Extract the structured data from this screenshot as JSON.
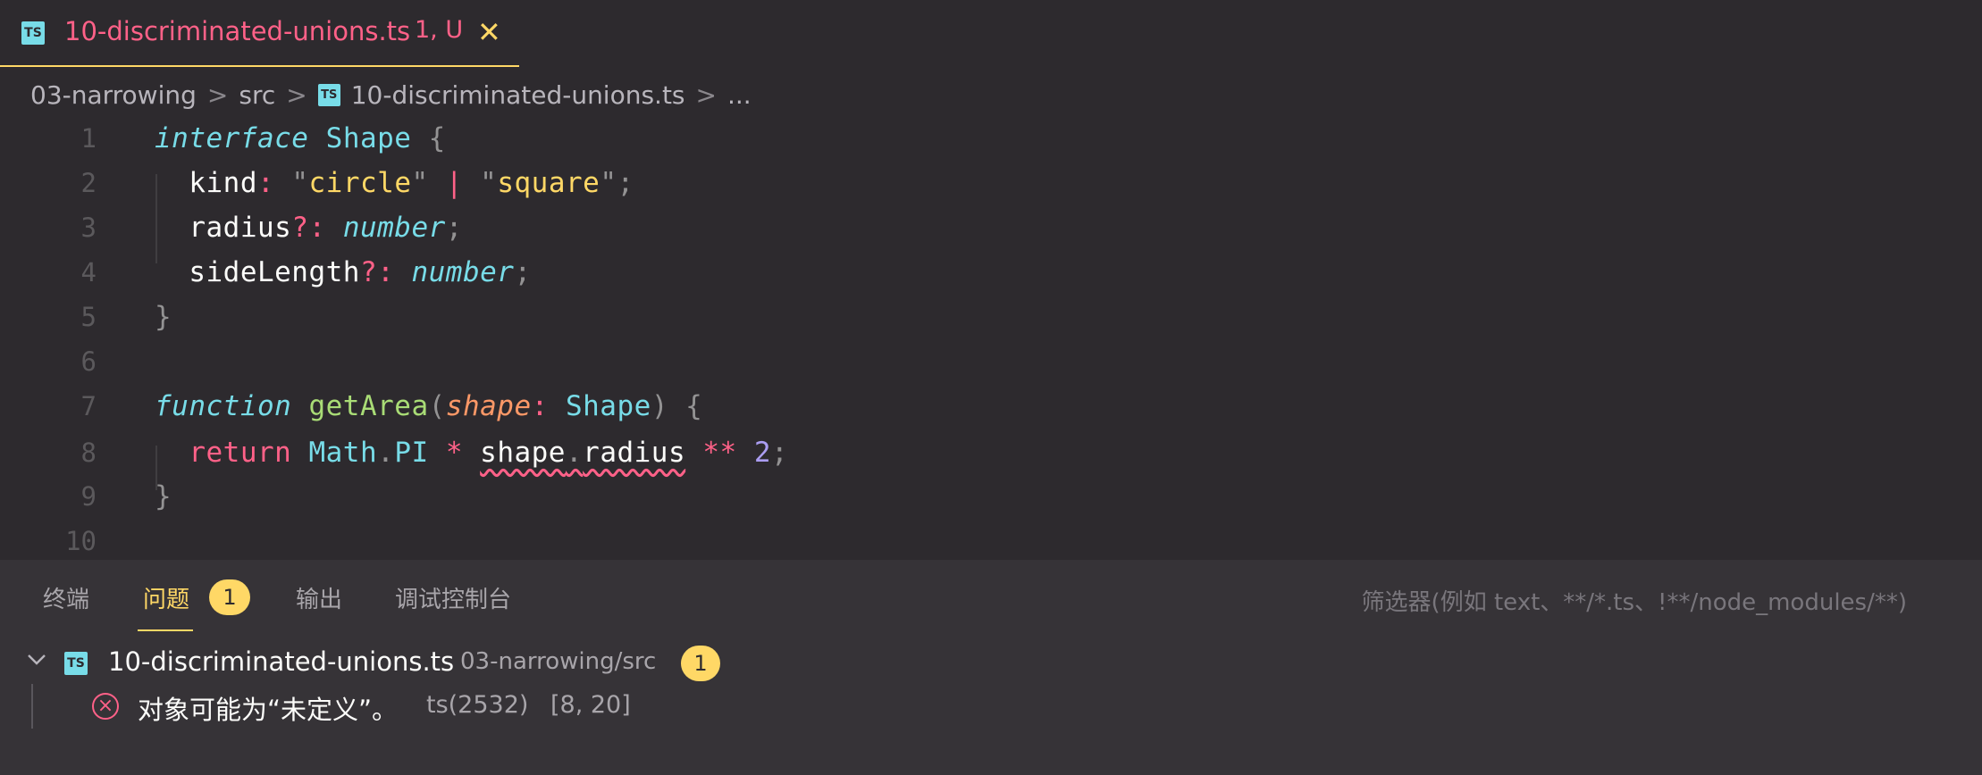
{
  "tab": {
    "icon_text": "TS",
    "filename": "10-discriminated-unions.ts",
    "status": "1, U",
    "close_glyph": "✕"
  },
  "breadcrumb": {
    "items": [
      "03-narrowing",
      "src",
      "10-discriminated-unions.ts",
      "..."
    ],
    "separator": ">"
  },
  "editor": {
    "line_numbers": [
      "1",
      "2",
      "3",
      "4",
      "5",
      "6",
      "7",
      "8",
      "9",
      "10"
    ]
  },
  "panel": {
    "tabs": [
      "终端",
      "问题",
      "输出",
      "调试控制台"
    ],
    "active_tab": "问题",
    "problems_count": "1",
    "filter_placeholder": "筛选器(例如 text、**/*.ts、!**/node_modules/**)",
    "file": {
      "name": "10-discriminated-unions.ts",
      "path": "03-narrowing/src",
      "count": "1"
    },
    "problem": {
      "message": "对象可能为“未定义”。",
      "code": "ts(2532)",
      "location": "[8, 20]"
    }
  },
  "colors": {
    "accent": "#ffd866",
    "error": "#ff6188",
    "type": "#78dce8",
    "function": "#a9dc76",
    "param": "#fc9867",
    "number": "#ab9df2"
  }
}
